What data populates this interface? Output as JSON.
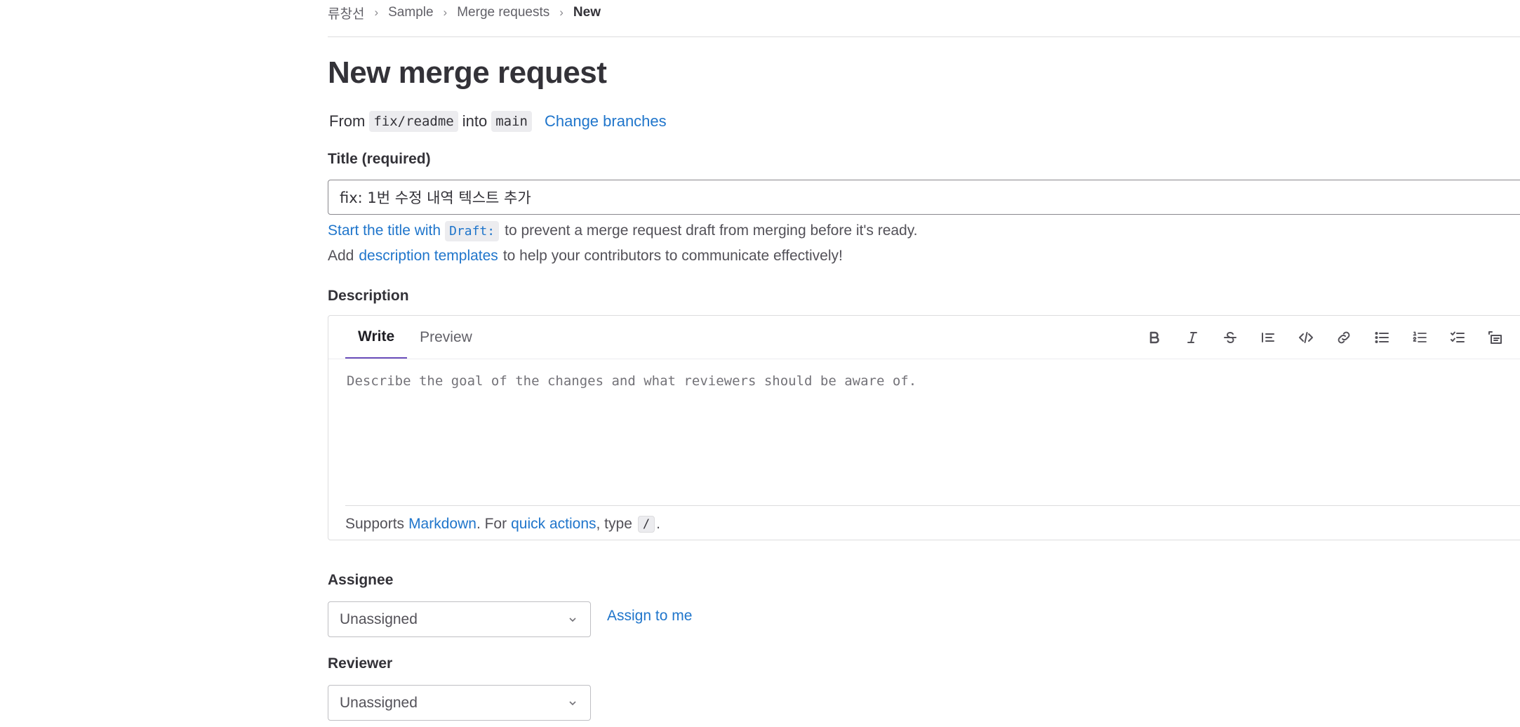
{
  "breadcrumb": {
    "items": [
      "류창선",
      "Sample",
      "Merge requests"
    ],
    "current": "New"
  },
  "page_title": "New merge request",
  "branches": {
    "from_text": "From",
    "source_branch": "fix/readme",
    "into_text": "into",
    "target_branch": "main",
    "change_link": "Change branches"
  },
  "title_field": {
    "label": "Title (required)",
    "value": "fix: 1번 수정 내역 텍스트 추가",
    "draft_hint_link": "Start the title with",
    "draft_code": "Draft:",
    "draft_hint_rest": "to prevent a merge request draft from merging before it's ready.",
    "templates_prefix": "Add",
    "templates_link": "description templates",
    "templates_suffix": "to help your contributors to communicate effectively!"
  },
  "description": {
    "label": "Description",
    "tabs": [
      {
        "label": "Write",
        "active": true
      },
      {
        "label": "Preview",
        "active": false
      }
    ],
    "toolbar_icons": [
      "bold-icon",
      "italic-icon",
      "strikethrough-icon",
      "quote-icon",
      "code-icon",
      "link-icon",
      "bullet-list-icon",
      "numbered-list-icon",
      "task-list-icon",
      "collapsible-section-icon"
    ],
    "placeholder": "Describe the goal of the changes and what reviewers should be aware of.",
    "footer": {
      "supports": "Supports",
      "markdown_link": "Markdown",
      "for_text": ". For",
      "quick_actions_link": "quick actions",
      "type_text": ", type",
      "slash": "/",
      "period": "."
    }
  },
  "assignee": {
    "label": "Assignee",
    "value": "Unassigned",
    "assign_me": "Assign to me"
  },
  "reviewer": {
    "label": "Reviewer",
    "value": "Unassigned"
  },
  "colors": {
    "link": "#1f75cb",
    "active_tab_underline": "#6b4fbb",
    "text": "#333238"
  }
}
